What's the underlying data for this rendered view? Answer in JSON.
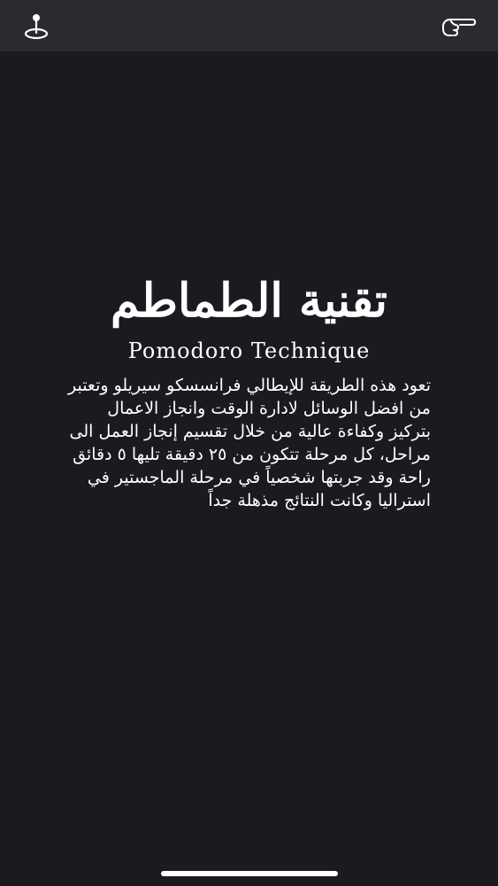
{
  "app": {
    "title_ar": "تقنية الطماطم",
    "title_en": "Pomodoro Technique",
    "description": "تعود هذه الطريقة للإيطالي فرانسسكو سيريلو وتعتبر من افضل الوسائل لادارة الوقت وانجاز الاعمال بتركيز وكفاءة عالية من خلال تقسيم إنجاز العمل الى مراحل، كل مرحلة تتكون من ٢٥ دقيقة تليها ٥ دقائق راحة وقد جربتها شخصياً في مرحلة الماجستير في استراليا وكانت النتائج مذهلة جداً"
  },
  "top_bar": {
    "left_icon": "map-pin-icon",
    "right_icon": "pointing-hand-icon"
  },
  "colors": {
    "background": "#1b1a20",
    "top_bar": "#2b2b2f",
    "text": "#ffffff"
  }
}
